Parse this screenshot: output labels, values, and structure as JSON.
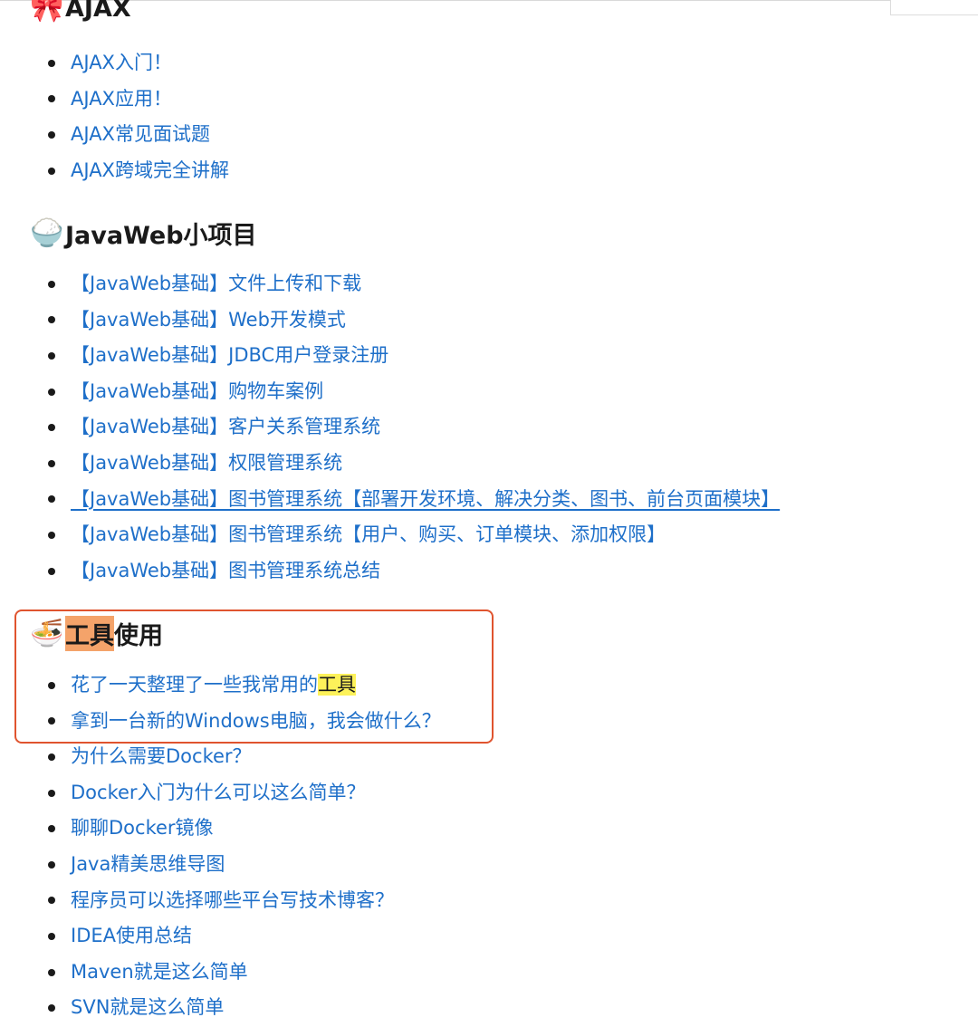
{
  "sections": [
    {
      "emoji": "🎀",
      "title": "AJAX",
      "items": [
        "AJAX入门！",
        "AJAX应用！",
        "AJAX常见面试题",
        "AJAX跨域完全讲解"
      ]
    },
    {
      "emoji": "🍚",
      "title": "JavaWeb小项目",
      "items": [
        "【JavaWeb基础】文件上传和下载",
        "【JavaWeb基础】Web开发模式",
        "【JavaWeb基础】JDBC用户登录注册",
        "【JavaWeb基础】购物车案例",
        "【JavaWeb基础】客户关系管理系统",
        "【JavaWeb基础】权限管理系统",
        "【JavaWeb基础】图书管理系统【部署开发环境、解决分类、图书、前台页面模块】",
        "【JavaWeb基础】图书管理系统【用户、购买、订单模块、添加权限】",
        "【JavaWeb基础】图书管理系统总结"
      ]
    },
    {
      "emoji": "🍜",
      "title_highlighted": "工具",
      "title_rest": "使用",
      "items": [
        {
          "text": "花了一天整理了一些我常用的",
          "highlight": "工具"
        },
        "拿到一台新的Windows电脑，我会做什么？",
        "为什么需要Docker？",
        "Docker入门为什么可以这么简单？",
        "聊聊Docker镜像",
        "Java精美思维导图",
        "程序员可以选择哪些平台写技术博客？",
        "IDEA使用总结",
        "Maven就是这么简单",
        "SVN就是这么简单"
      ]
    }
  ],
  "colors": {
    "link": "#1e6fc9",
    "box_border": "#e0542f",
    "highlight_orange": "#f4a36a",
    "highlight_yellow": "#fdf25a"
  }
}
